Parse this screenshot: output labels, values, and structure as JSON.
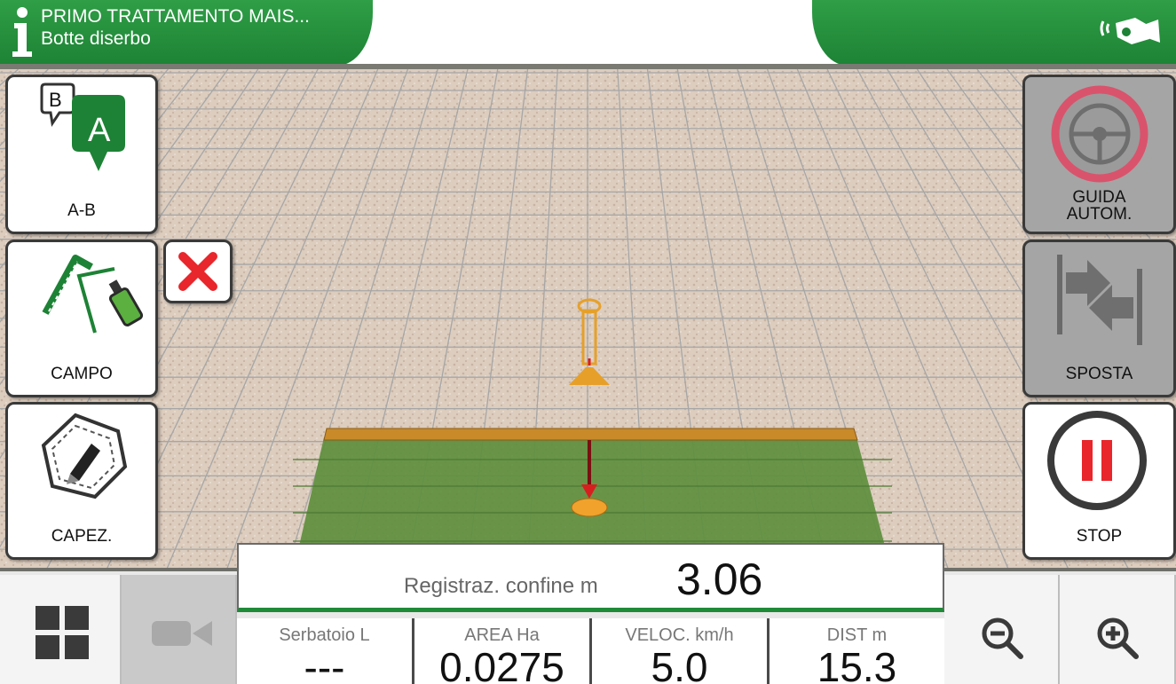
{
  "header": {
    "title": "PRIMO TRATTAMENTO MAIS...",
    "subtitle": "Botte diserbo",
    "accent": "#1d8235"
  },
  "left_buttons": {
    "ab": {
      "label": "A-B",
      "marker_a": "A",
      "marker_b": "B"
    },
    "campo": {
      "label": "CAMPO"
    },
    "capez": {
      "label": "CAPEZ."
    },
    "close": {
      "icon": "close-icon"
    }
  },
  "right_buttons": {
    "guida": {
      "label_line1": "GUIDA",
      "label_line2": "AUTOM."
    },
    "sposta": {
      "label": "SPOSTA"
    },
    "stop": {
      "label": "STOP"
    }
  },
  "record": {
    "label": "Registraz. confine m",
    "value": "3.06"
  },
  "stats": [
    {
      "label": "Serbatoio L",
      "value": "---"
    },
    {
      "label": "AREA Ha",
      "value": "0.0275"
    },
    {
      "label": "VELOC. km/h",
      "value": "5.0"
    },
    {
      "label": "DIST m",
      "value": "15.3"
    }
  ],
  "bottom_buttons": {
    "menu": "grid-icon",
    "camera": "camera-icon",
    "zoom_out": "zoom-out-icon",
    "zoom_in": "zoom-in-icon"
  },
  "colors": {
    "green": "#1d8235",
    "field": "#d9c9bb",
    "coverage": "#5a8f3d",
    "boom": "#c9821c",
    "stop_red": "#e8262b",
    "guida_ring": "#d9536c"
  }
}
